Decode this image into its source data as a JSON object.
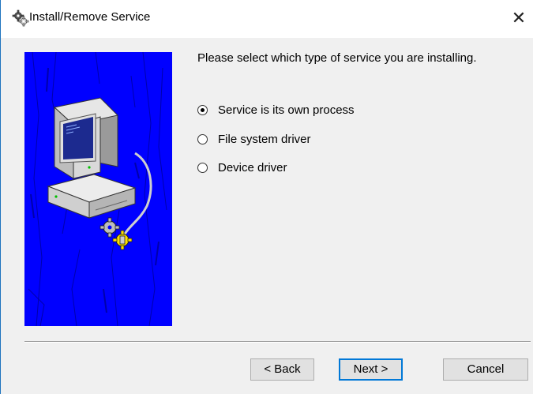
{
  "window": {
    "title": "Install/Remove Service",
    "title_icon": "gears-icon",
    "close_glyph": "✕"
  },
  "main": {
    "prompt": "Please select which type of service you are installing.",
    "options": [
      {
        "label": "Service is its own process",
        "checked": true
      },
      {
        "label": "File system driver",
        "checked": false
      },
      {
        "label": "Device driver",
        "checked": false
      }
    ]
  },
  "buttons": {
    "back": "< Back",
    "next": "Next >",
    "cancel": "Cancel"
  },
  "colors": {
    "image_background": "#0000ff",
    "window_border": "#1e73be",
    "default_button_border": "#0078d7",
    "dialog_background": "#f0f0f0"
  }
}
